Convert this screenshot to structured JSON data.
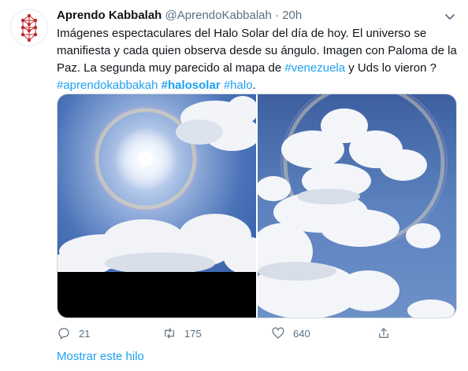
{
  "tweet": {
    "author_name": "Aprendo Kabbalah",
    "author_handle": "@AprendoKabbalah",
    "separator": "·",
    "time": "20h",
    "text_part1": "Imágenes espectaculares del Halo Solar del día de hoy. El universo se manifiesta y cada quien observa desde su ángulo. Imagen con Paloma de la Paz. La segunda muy parecido al mapa de ",
    "hashtag_venezuela": "#venezuela",
    "text_part2": " y Uds lo vieron ? ",
    "hashtag_aprendo": "#aprendokabbakah",
    "hashtag_halosolar": "#halosolar",
    "hashtag_halo": "#halo",
    "text_part3": "."
  },
  "actions": {
    "reply_count": "21",
    "retweet_count": "175",
    "like_count": "640"
  },
  "footer": {
    "show_thread": "Mostrar este hilo"
  },
  "colors": {
    "accent": "#1da1f2",
    "muted": "#5b7083",
    "avatar_red": "#c0272d"
  },
  "icons": {
    "avatar": "tree-of-life-logo",
    "more": "chevron-down-icon",
    "reply": "reply-icon",
    "retweet": "retweet-icon",
    "like": "heart-icon",
    "share": "share-icon"
  }
}
